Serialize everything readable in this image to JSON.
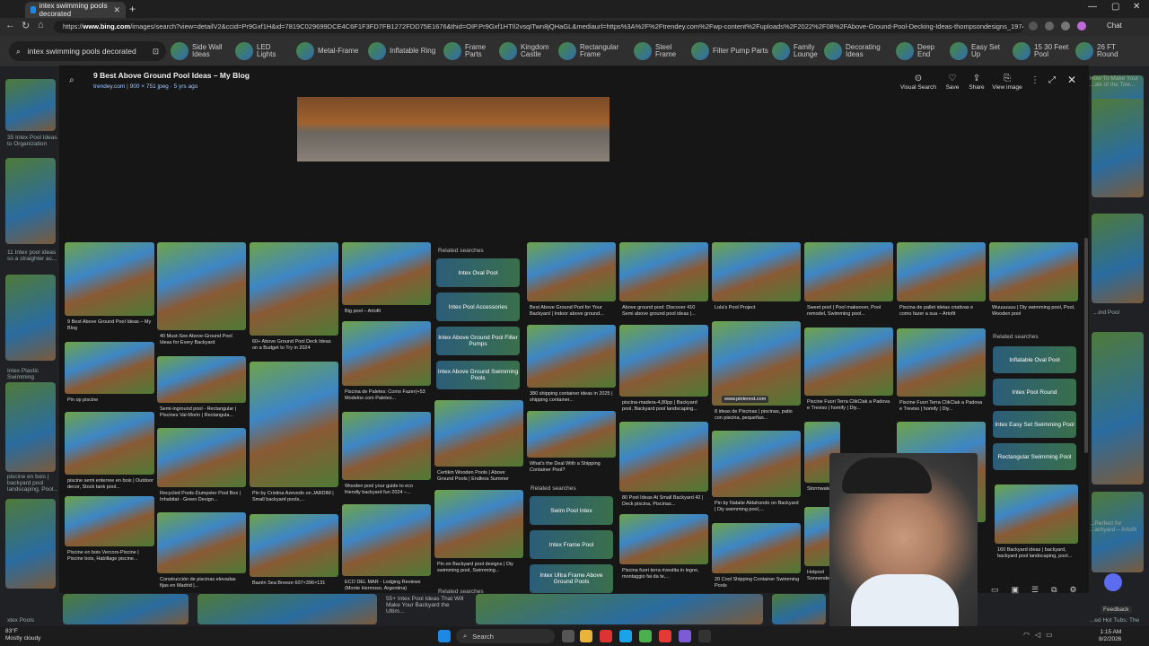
{
  "browser": {
    "tab_title": "intex swimming pools decorated",
    "url_prefix": "https://",
    "url_domain": "www.bing.com",
    "url_rest": "/images/search?view=detailV2&ccid=Pr9Gxf1H&id=7819C029699DCE4C6F1F3FD7FB1272FDD75E1676&thid=OIP.Pr9Gxf1HTIl2vsqITwn8jQHaGL&mediaurl=https%3A%2F%2Ftrendey.com%2Fwp-content%2Fuploads%2F2022%2F08%2FAbove-Ground-Pool-Decking-Ideas-thompsondesigns_1974.jpg&cdnurl=https%3A%2F..."
  },
  "search": {
    "query": "intex swimming pools decorated",
    "chips": [
      {
        "label": "Side Wall Ideas"
      },
      {
        "label": "LED Lights"
      },
      {
        "label": "Metal-Frame"
      },
      {
        "label": "Inflatable Ring"
      },
      {
        "label": "Frame Parts"
      },
      {
        "label": "Kingdom Castle"
      },
      {
        "label": "Rectangular Frame"
      },
      {
        "label": "Steel Frame"
      },
      {
        "label": "Filter Pump Parts"
      },
      {
        "label": "Family Lounge"
      },
      {
        "label": "Decorating Ideas"
      },
      {
        "label": "Deep End"
      },
      {
        "label": "Easy Set Up"
      },
      {
        "label": "15 30 Feet Pool"
      },
      {
        "label": "26 FT Round"
      }
    ]
  },
  "modal": {
    "title": "9 Best Above Ground Pool Ideas – My Blog",
    "source": "trendey.com",
    "meta": "900 × 751 jpeg · 5 yrs ago",
    "actions": [
      {
        "label": "Visual Search",
        "icon": "visual-search-icon"
      },
      {
        "label": "Save",
        "icon": "save-icon"
      },
      {
        "label": "Share",
        "icon": "share-icon"
      },
      {
        "label": "View image",
        "icon": "view-image-icon"
      }
    ],
    "related_head_1": "Related searches",
    "related_1": [
      "Intex Oval Pool",
      "Intex Pool Accessories",
      "Intex Above Ground Pool Filter Pumps",
      "Intex Above Ground Swimming Pools"
    ],
    "related_head_2": "Related searches",
    "related_2": [
      "Swim Pool Intex",
      "Intex Frame Pool",
      "Intex Ultra Frame Above Ground Pools"
    ],
    "related_head_3": "Related searches",
    "related_3": [
      "Inflatable Oval Pool",
      "Intex Pool Round",
      "Intex Easy Set Swimming Pool",
      "Rectangular Swimming Pool"
    ],
    "related_head_4": "Related searches",
    "cards": [
      {
        "cap": "9 Best Above Ground Pool Ideas – My Blog"
      },
      {
        "cap": "Pin op piscine"
      },
      {
        "cap": "piscine semi enterree en bois | Outdoor decor, Stock tank pool..."
      },
      {
        "cap": "Piscine en bois Vercors-Piscine | Piscine bois, Habillage piscine..."
      },
      {
        "cap": "40 Must-See Above-Ground Pool Ideas for Every Backyard"
      },
      {
        "cap": "Semi-inground pool - Rectangular | Piscines Val-Morin | Rectangula..."
      },
      {
        "cap": "Recycled Pools-Dumpster Pool Box | Inhabitat - Green Design..."
      },
      {
        "cap": "Construcción de piscinas elevadas fijas en Madrid |..."
      },
      {
        "cap": "60+ Above Ground Pool Deck Ideas on a Budget to Try in 2024"
      },
      {
        "cap": "Pin by Cristina Azevedo on JARDIM | Small backyard pools,..."
      },
      {
        "cap": "Bazén Sea Breeze 607×396×131"
      },
      {
        "cap": "Big pool – Artofit"
      },
      {
        "cap": "Piscina de Paletes: Como Fazer(+53 Modelos com Paletes..."
      },
      {
        "cap": "Wooden pool your guide to eco friendly backyard fun 2024 –..."
      },
      {
        "cap": "ECO DEL MAR - Lodging Reviews (Monte Hermoso, Argentina)"
      },
      {
        "cap": "Certikin Wooden Pools | Above Ground Pools | Endless Summer"
      },
      {
        "cap": "Pin on Backyard pool designs | Diy swimming pool, Swimming..."
      },
      {
        "cap": "Best Above Ground Pool for Your Backyard | Indoor above ground..."
      },
      {
        "cap": "380 shipping container ideas in 2025 | shipping container..."
      },
      {
        "cap": "What's the Deal With a Shipping Container Pool?"
      },
      {
        "cap": "Above ground pool: Discover 410 Semi above ground pool ideas |..."
      },
      {
        "cap": "piscina-madera-4,80pp | Backyard pool, Backyard pool landscaping..."
      },
      {
        "cap": "80 Pool Ideas At Small Backyard 42 | Deck piscina, Piscinas..."
      },
      {
        "cap": "Piscina fuori terra rivestita in legno, montaggio fai da te,..."
      },
      {
        "cap": "Lola's Pool Project"
      },
      {
        "cap": "8 ideas de Piscinas | piscinas, patio con piscina, pequeñas..."
      },
      {
        "cap": "Pin by Natalie Aldahondo on Backyard | Diy swimming pool,..."
      },
      {
        "cap": "20 Cool Shipping Container Swimming Pools"
      },
      {
        "cap": "Sweet pool | Pool makeover, Pool remodel, Swimming pool..."
      },
      {
        "cap": "Piscine Fuori Terra ClikClak a Padova e Treviso | homify | Diy..."
      },
      {
        "cap": "Stormwater"
      },
      {
        "cap": "Hotpool Sonnendeck"
      },
      {
        "cap": "Piscina de pallet ideias criativas e como fazer a sua – Artofit"
      },
      {
        "cap": "Piscine Fuori Terra ClikClak a Padova e Treviso | homify | Diy..."
      },
      {
        "cap": "Perfect for backyard,..."
      },
      {
        "cap": "Wuuuuuuu | Diy swimming pool, Pool, Wooden pool"
      },
      {
        "cap": "160 Backyard ideas | backyard, backyard pool landscaping, pool..."
      }
    ],
    "hover_link": "www.pinterest.com"
  },
  "background_captions": [
    "35 Intex Pool Ideas to Organization",
    "11 Intex pool ideas so a straighter ac...",
    "Intex Plastic Swimming",
    "piscine en bois | backyard pool landscaping, Pool...",
    "xtex Pools",
    "How To Make Your ...alk of the Tow...",
    "...ind Pool",
    "...Perfect for ...ackyard – Artofit",
    "...ed Hot Tubs: The"
  ],
  "bottom_text": "55+ Intex Pool Ideas That Will Make Your Backyard the Ultim...",
  "taskbar": {
    "weather_temp": "83°F",
    "weather_desc": "Mostly cloudy",
    "search_label": "Search",
    "time": "1:15 AM",
    "date": "8/2/2026"
  },
  "feedback": "Feedback",
  "colors": {
    "accent": "#5b6cf0",
    "link": "#9ec7ff"
  }
}
